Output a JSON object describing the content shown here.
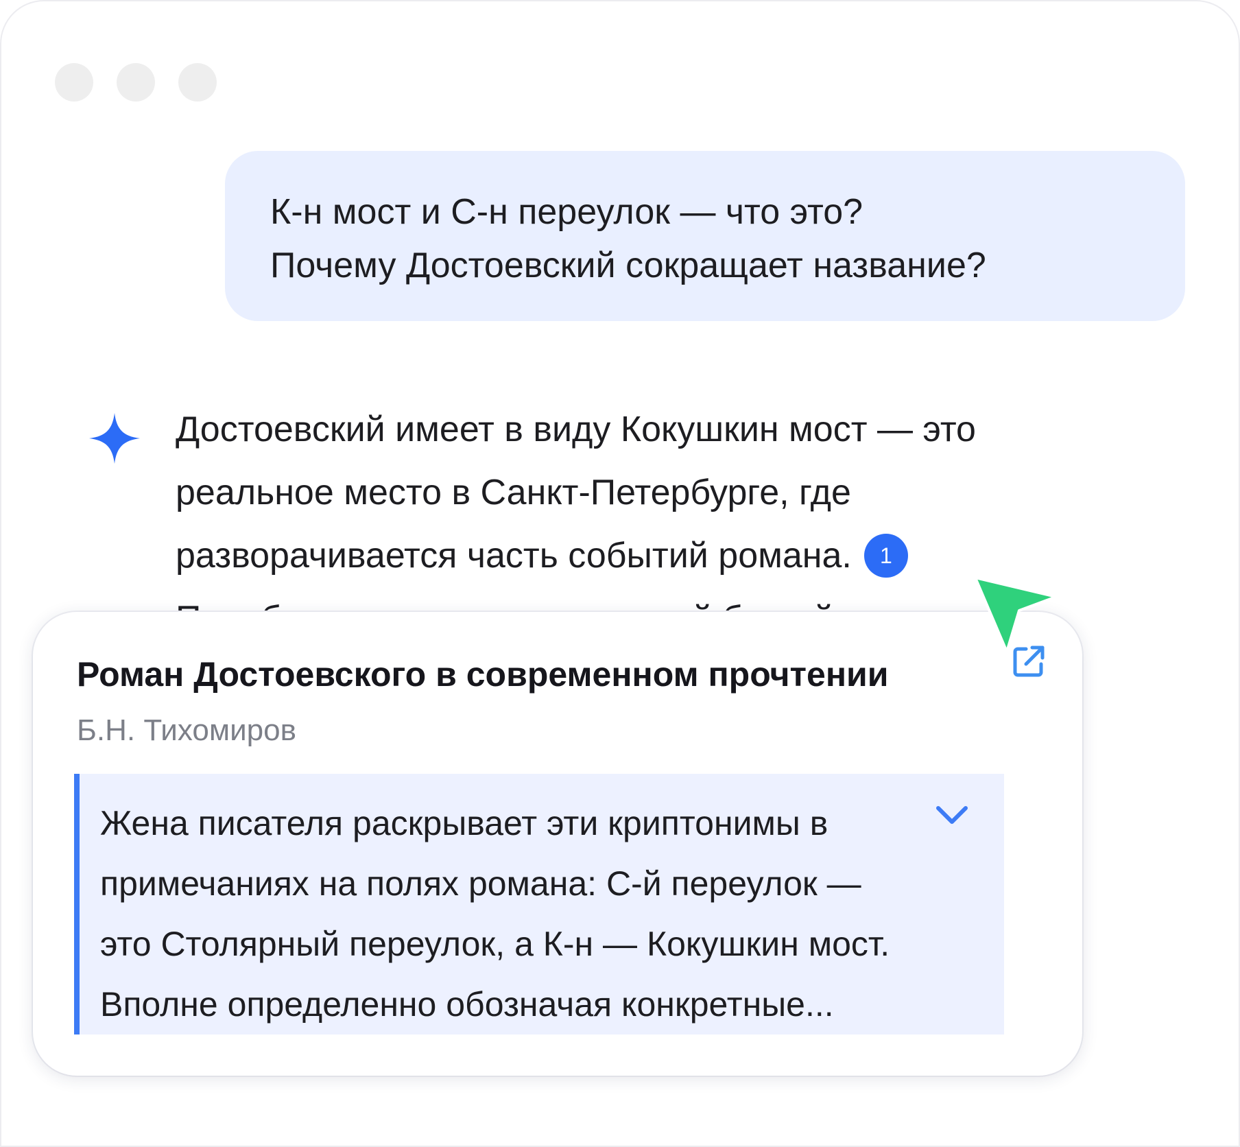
{
  "window": {
    "controls": [
      "window-dot",
      "window-dot",
      "window-dot"
    ]
  },
  "user_message": {
    "lines": [
      "К-н мост и С-н переулок — что это?",
      "Почему Достоевский сокращает название?"
    ]
  },
  "assistant": {
    "icon": "sparkle-icon",
    "lines": [
      "Достоевский имеет в виду Кокушкин мост — это",
      "реальное место в Санкт-Петербурге, где",
      "разворачивается часть событий романа.",
      "Подобные сокращения с первой буквой и"
    ],
    "citation_number": "1"
  },
  "source_card": {
    "title": "Роман Достоевского в современном прочтении",
    "author": "Б.Н. Тихомиров",
    "quote_lines": [
      "Жена писателя раскрывает эти криптонимы в",
      "примечаниях на полях романа: С-й переулок —",
      "это Столярный переулок, а К-н — Кокушкин мост.",
      "Вполне определенно обозначая конкретные..."
    ]
  },
  "colors": {
    "accent": "#2c6cf6",
    "bubble": "#e9efff",
    "quote_bg": "#edf1ff",
    "quote_border": "#3d7bf5",
    "cursor": "#2fd17c",
    "muted": "#7c7f88"
  },
  "icons": {
    "open_link": "external-link-icon",
    "expand": "chevron-down-icon",
    "pointer": "cursor-pointer-icon"
  }
}
